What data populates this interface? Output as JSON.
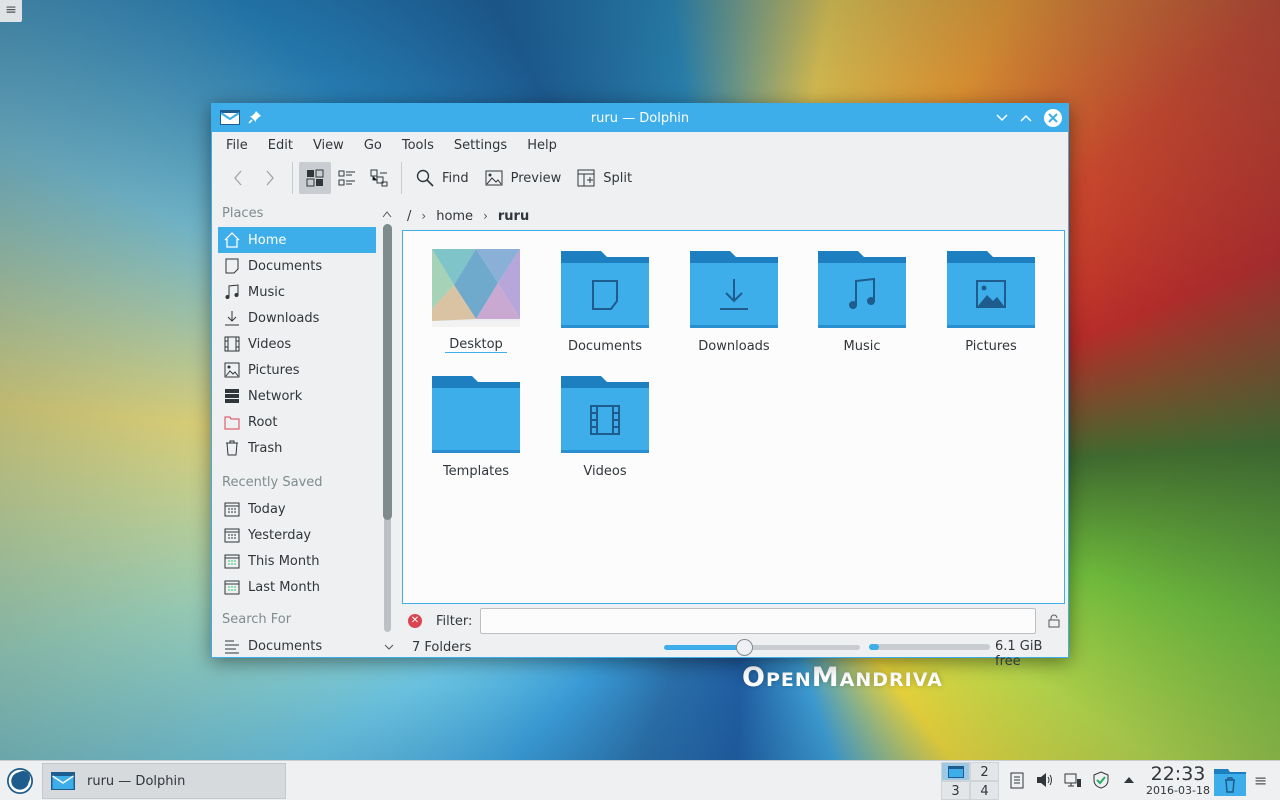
{
  "desktop": {
    "menu_icon": "hamburger-icon",
    "brand_text": "OpenMandriva"
  },
  "window": {
    "title": "ruru — Dolphin",
    "app_icon": "dolphin-folder-icon",
    "menu": [
      "File",
      "Edit",
      "View",
      "Go",
      "Tools",
      "Settings",
      "Help"
    ],
    "toolbar": {
      "find": "Find",
      "preview": "Preview",
      "split": "Split"
    },
    "breadcrumb": [
      "/",
      "home",
      "ruru"
    ],
    "sidebar": {
      "places_title": "Places",
      "places": [
        {
          "label": "Home",
          "icon": "home-icon",
          "selected": true
        },
        {
          "label": "Documents",
          "icon": "document-icon"
        },
        {
          "label": "Music",
          "icon": "music-icon"
        },
        {
          "label": "Downloads",
          "icon": "download-icon"
        },
        {
          "label": "Videos",
          "icon": "video-icon"
        },
        {
          "label": "Pictures",
          "icon": "picture-icon"
        },
        {
          "label": "Network",
          "icon": "network-icon"
        },
        {
          "label": "Root",
          "icon": "root-folder-icon"
        },
        {
          "label": "Trash",
          "icon": "trash-icon"
        }
      ],
      "recent_title": "Recently Saved",
      "recent": [
        {
          "label": "Today",
          "icon": "calendar-icon"
        },
        {
          "label": "Yesterday",
          "icon": "calendar-icon"
        },
        {
          "label": "This Month",
          "icon": "calendar-icon"
        },
        {
          "label": "Last Month",
          "icon": "calendar-icon"
        }
      ],
      "search_title": "Search For",
      "search": [
        {
          "label": "Documents",
          "icon": "text-lines-icon"
        }
      ]
    },
    "files": [
      {
        "name": "Desktop",
        "icon": "desktop-wallpaper-thumbnail"
      },
      {
        "name": "Documents",
        "icon": "folder-documents-icon"
      },
      {
        "name": "Downloads",
        "icon": "folder-downloads-icon"
      },
      {
        "name": "Music",
        "icon": "folder-music-icon"
      },
      {
        "name": "Pictures",
        "icon": "folder-pictures-icon"
      },
      {
        "name": "Templates",
        "icon": "folder-icon"
      },
      {
        "name": "Videos",
        "icon": "folder-videos-icon"
      }
    ],
    "filter": {
      "label": "Filter:",
      "value": ""
    },
    "status": {
      "text": "7 Folders",
      "zoom_level": 0.4,
      "space_used_fraction": 0.08,
      "free_space": "6.1 GiB free"
    }
  },
  "panel": {
    "task_label": "ruru — Dolphin",
    "pager": [
      "1",
      "2",
      "3",
      "4"
    ],
    "time": "22:33",
    "date": "2016-03-18",
    "colors": {
      "accent": "#3daee9",
      "folder": "#3daee9",
      "folder_tab": "#1d7fbf"
    }
  }
}
